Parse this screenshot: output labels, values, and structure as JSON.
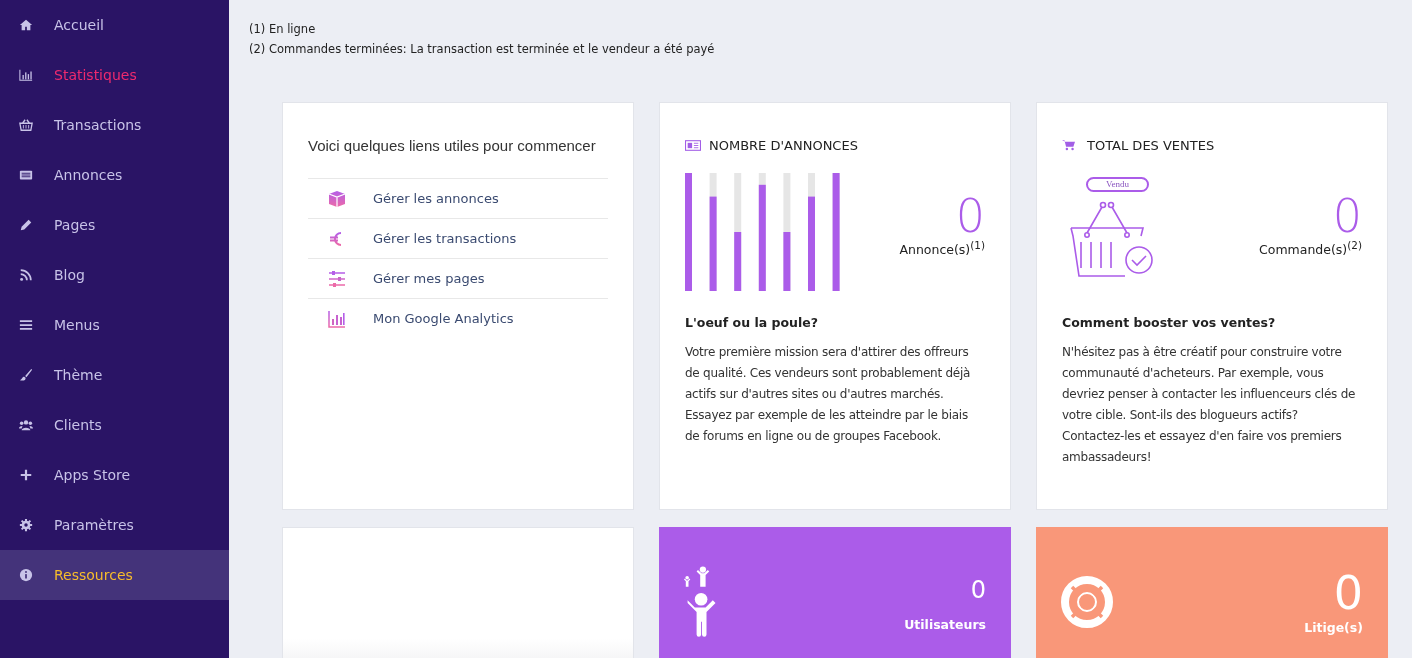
{
  "sidebar": {
    "items": [
      {
        "label": "Accueil",
        "kind": "home",
        "selected": false,
        "highlighted": false
      },
      {
        "label": "Statistiques",
        "kind": "stats",
        "selected": true,
        "highlighted": false
      },
      {
        "label": "Transactions",
        "kind": "basket",
        "selected": false,
        "highlighted": false
      },
      {
        "label": "Annonces",
        "kind": "list",
        "selected": false,
        "highlighted": false
      },
      {
        "label": "Pages",
        "kind": "pencil",
        "selected": false,
        "highlighted": false
      },
      {
        "label": "Blog",
        "kind": "rss",
        "selected": false,
        "highlighted": false
      },
      {
        "label": "Menus",
        "kind": "menu",
        "selected": false,
        "highlighted": false
      },
      {
        "label": "Thème",
        "kind": "brush",
        "selected": false,
        "highlighted": false
      },
      {
        "label": "Clients",
        "kind": "users",
        "selected": false,
        "highlighted": false
      },
      {
        "label": "Apps Store",
        "kind": "plus",
        "selected": false,
        "highlighted": false
      },
      {
        "label": "Paramètres",
        "kind": "gear",
        "selected": false,
        "highlighted": false
      },
      {
        "label": "Ressources",
        "kind": "info",
        "selected": false,
        "highlighted": true
      }
    ]
  },
  "notes": [
    "(1) En ligne",
    "(2) Commandes terminées: La transaction est terminée et le vendeur a été payé"
  ],
  "links_card": {
    "title": "Voici quelques liens utiles pour commencer",
    "links": [
      {
        "label": "Gérer les annonces",
        "kind": "cube"
      },
      {
        "label": "Gérer les transactions",
        "kind": "euro"
      },
      {
        "label": "Gérer mes pages",
        "kind": "sliders"
      },
      {
        "label": "Mon Google Analytics",
        "kind": "chart"
      }
    ]
  },
  "stat_cards": [
    {
      "kind": "listings",
      "title": "NOMBRE D'ANNONCES",
      "value": "0",
      "unit": "Annonce(s)$^{(1)}$",
      "heading": "L'oeuf ou la poule?",
      "text": "Votre première mission sera d'attirer des offreurs de qualité. Ces vendeurs sont probablement déjà actifs sur d'autres sites ou d'autres marchés. Essayez par exemple de les atteindre par le biais de forums en ligne ou de groupes Facebook."
    },
    {
      "kind": "sales",
      "title": "TOTAL DES VENTES",
      "badge": "Vendu",
      "value": "0",
      "unit": "Commande(s)$^{(2)}$",
      "heading": "Comment booster vos ventes?",
      "text": "N'hésitez pas à être créatif pour construire votre communauté d'acheteurs. Par exemple, vous devriez penser à contacter les influenceurs clés de votre cible. Sont-ils des blogueurs actifs? Contactez-les et essayez d'en faire vos premiers ambassadeurs!"
    }
  ],
  "tiles": [
    {
      "kind": "users",
      "value": "0",
      "label": "Utilisateurs"
    },
    {
      "kind": "disputes",
      "value": "0",
      "label": "Litige(s)"
    }
  ]
}
